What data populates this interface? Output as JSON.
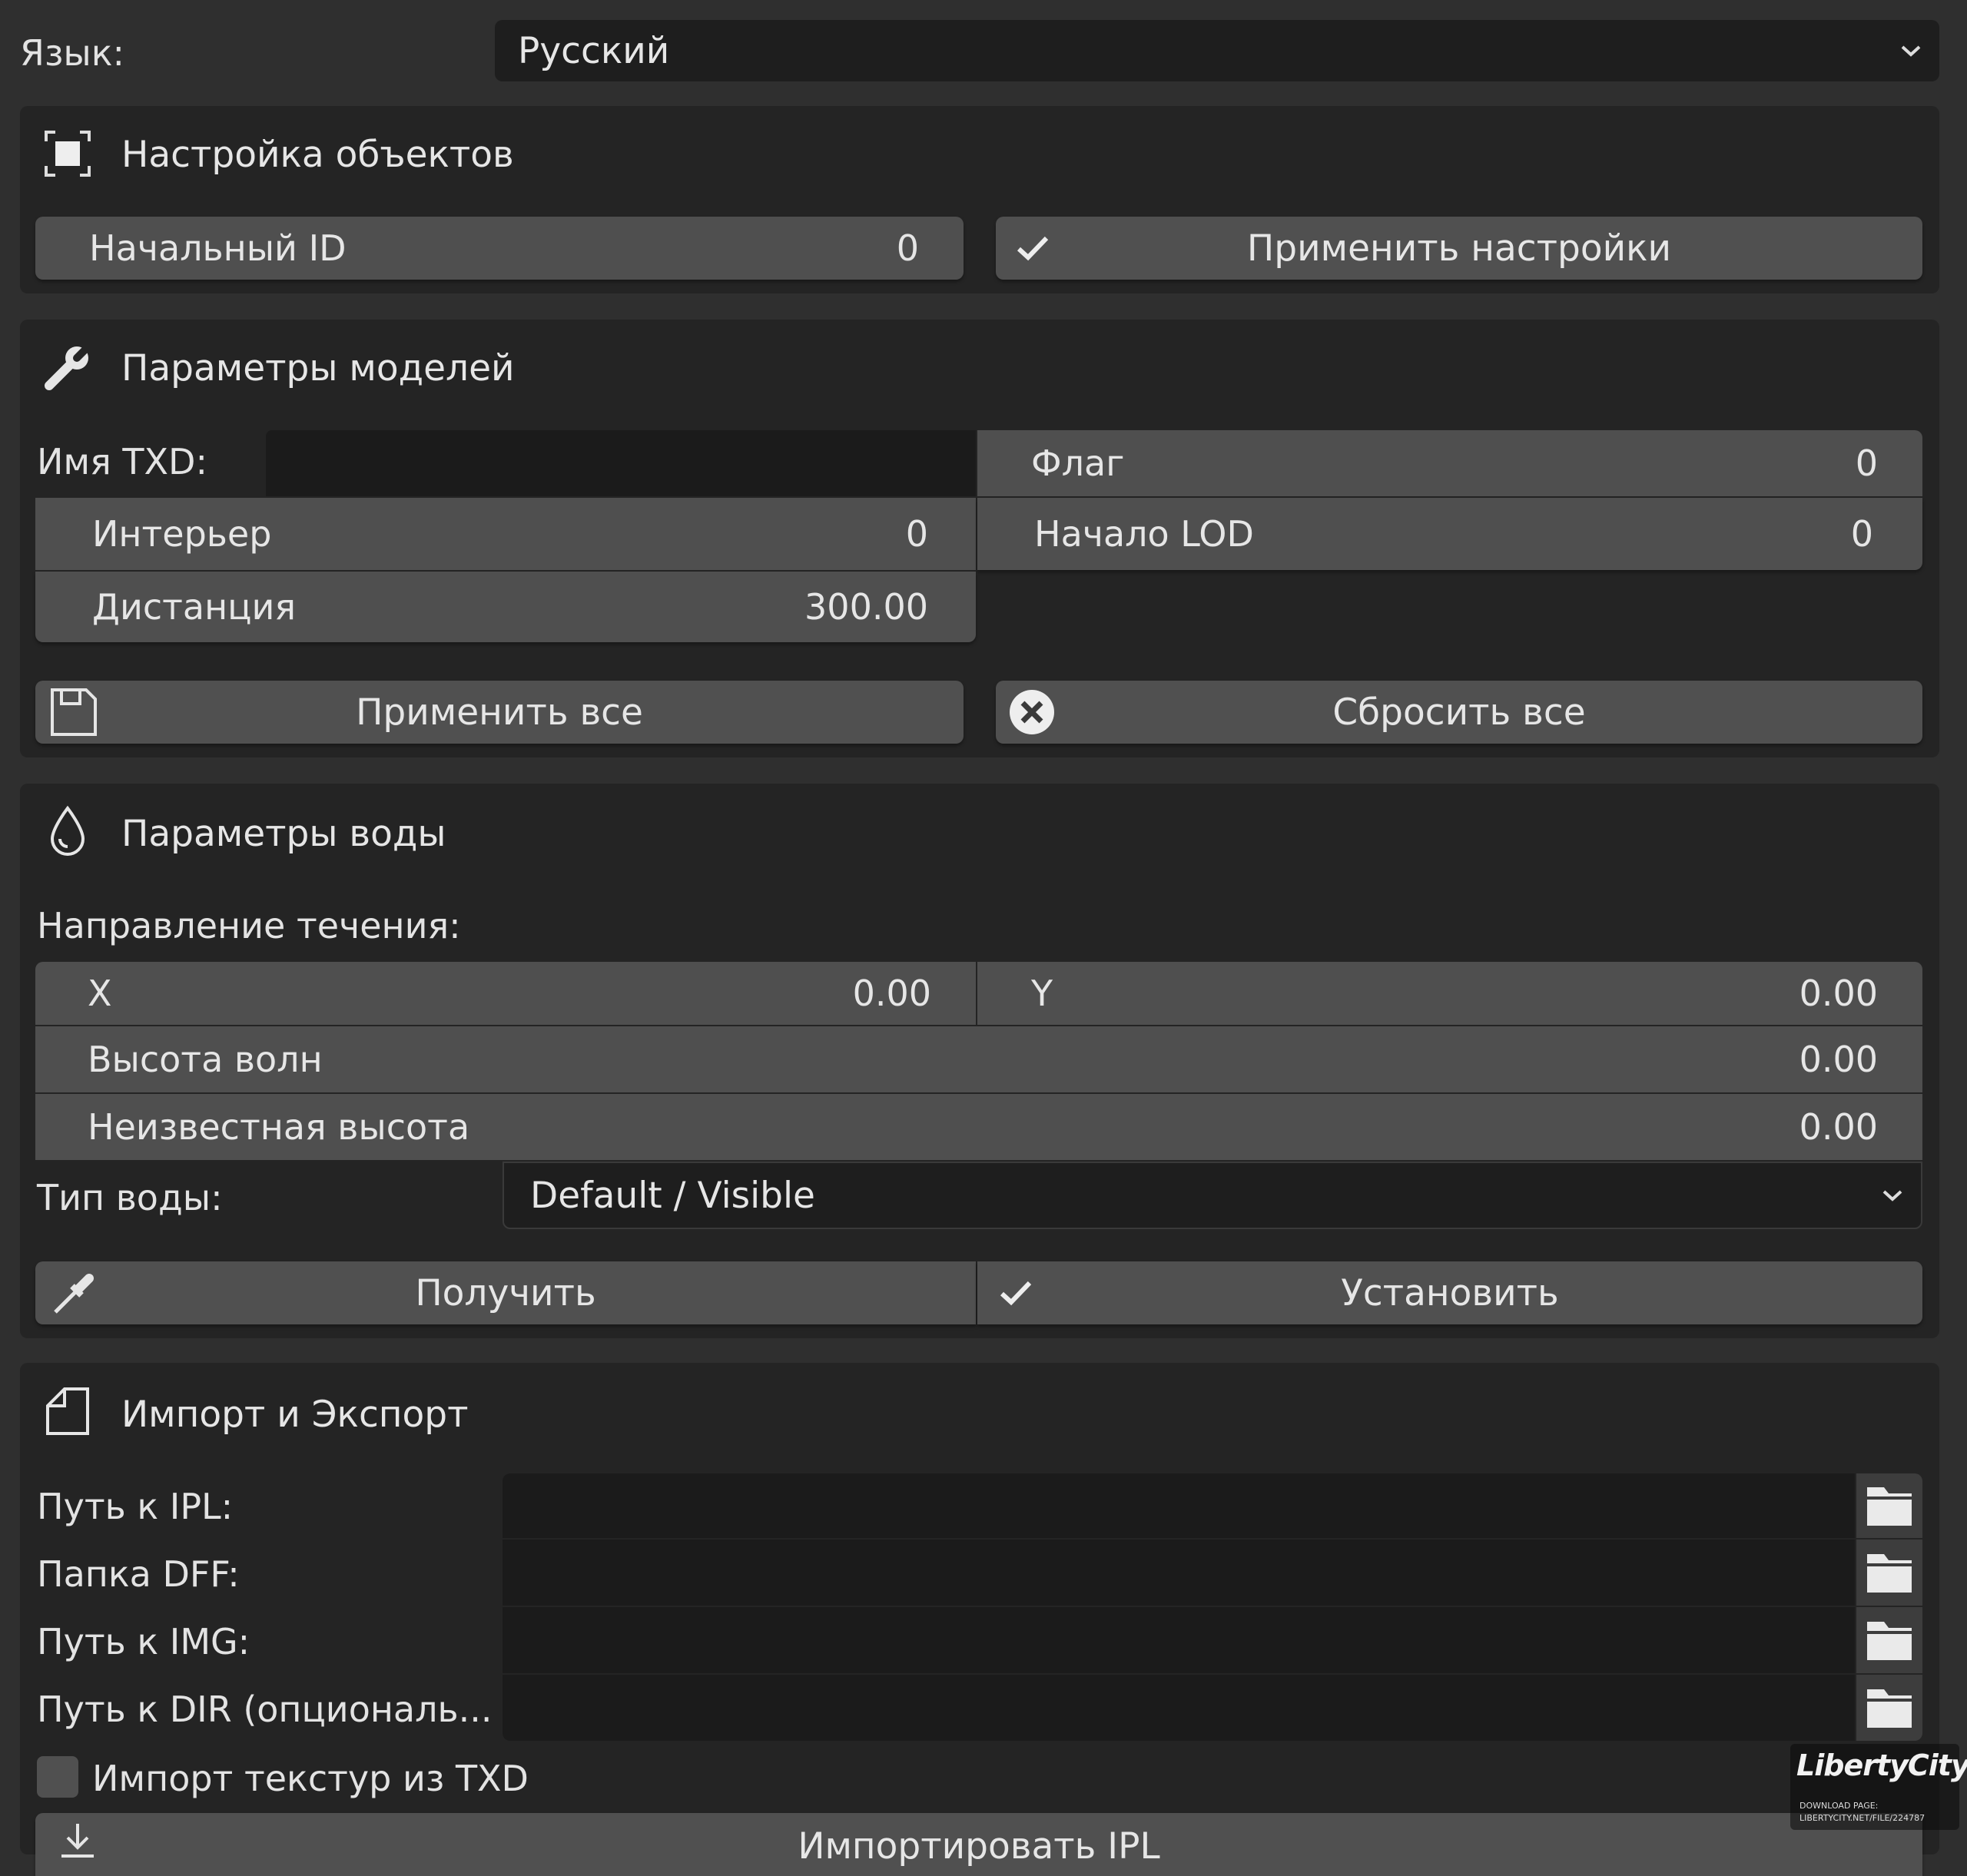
{
  "language": {
    "label": "Язык:",
    "value": "Русский"
  },
  "objects": {
    "title": "Настройка объектов",
    "start_id_label": "Начальный ID",
    "start_id_value": "0",
    "apply_label": "Применить настройки"
  },
  "models": {
    "title": "Параметры моделей",
    "txd_label": "Имя TXD:",
    "txd_value": "",
    "flag_label": "Флаг",
    "flag_value": "0",
    "interior_label": "Интерьер",
    "interior_value": "0",
    "lod_label": "Начало LOD",
    "lod_value": "0",
    "distance_label": "Дистанция",
    "distance_value": "300.00",
    "apply_all": "Применить все",
    "reset_all": "Сбросить все"
  },
  "water": {
    "title": "Параметры воды",
    "flow_label": "Направление течения:",
    "x_label": "X",
    "x_value": "0.00",
    "y_label": "Y",
    "y_value": "0.00",
    "wave_label": "Высота волн",
    "wave_value": "0.00",
    "unknown_label": "Неизвестная высота",
    "unknown_value": "0.00",
    "type_label": "Тип воды:",
    "type_value": "Default / Visible",
    "get_label": "Получить",
    "set_label": "Установить"
  },
  "io": {
    "title": "Импорт и Экспорт",
    "ipl_label": "Путь к IPL:",
    "dff_label": "Папка DFF:",
    "img_label": "Путь к IMG:",
    "dir_label": "Путь к DIR (опциональ...",
    "import_txd_label": "Импорт текстур из TXD",
    "import_txd_checked": false,
    "import_ipl_label": "Импортировать IPL"
  },
  "watermark": {
    "brand": "LibertyCity",
    "line1": "DOWNLOAD PAGE:",
    "line2": "LIBERTYCITY.NET/FILE/224787"
  },
  "colors": {
    "background": "#2f2f2f",
    "panel": "#242424",
    "field": "#4f4f4f",
    "input": "#1b1b1b",
    "text": "#e3e3e3"
  }
}
